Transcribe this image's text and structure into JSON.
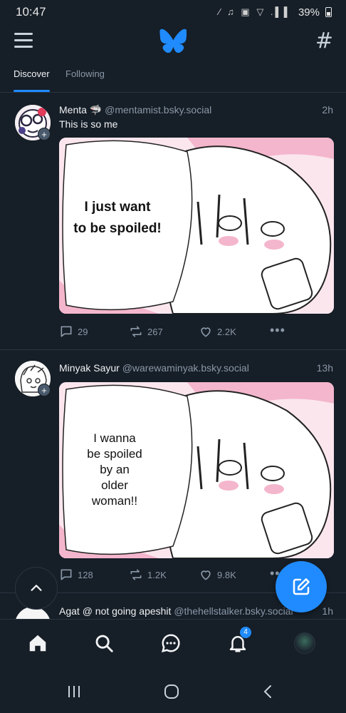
{
  "status_bar": {
    "time": "10:47",
    "icons": "∕ ♫ ▣ ▽ .▌▌",
    "battery": "39%"
  },
  "header": {
    "menu_icon": "hamburger-icon",
    "logo_icon": "butterfly-icon",
    "feeds_icon": "#"
  },
  "tabs": [
    {
      "label": "Discover",
      "active": true
    },
    {
      "label": "Following",
      "active": false
    }
  ],
  "posts": [
    {
      "display_name": "Menta 🦈",
      "handle": "@mentamist.bsky.social",
      "time": "2h",
      "text": "This is so me",
      "image_text": [
        "I just want",
        "to be spoiled!"
      ],
      "replies": "29",
      "reposts": "267",
      "likes": "2.2K"
    },
    {
      "display_name": "Minyak Sayur",
      "handle": "@warewaminyak.bsky.social",
      "time": "13h",
      "text": "",
      "image_text": [
        "I wanna",
        "be spoiled",
        "by an",
        "older",
        "woman!!"
      ],
      "replies": "128",
      "reposts": "1.2K",
      "likes": "9.8K"
    },
    {
      "display_name": "Agat @ not going apeshit",
      "handle": "@thehellstalker.bsky.social",
      "time": "1h"
    }
  ],
  "bottom_nav": {
    "notifications_count": "4",
    "items": [
      "home-icon",
      "search-icon",
      "chat-icon",
      "bell-icon",
      "profile-avatar"
    ]
  },
  "colors": {
    "background": "#161e27",
    "accent": "#208bfe",
    "muted": "#8a98a8",
    "divider": "#2a3541"
  }
}
